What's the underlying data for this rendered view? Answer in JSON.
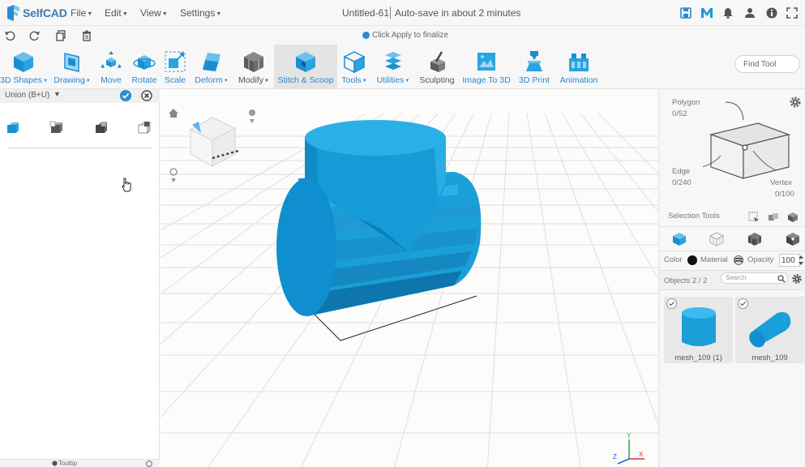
{
  "app": {
    "name": "SelfCAD"
  },
  "menu": [
    "File",
    "Edit",
    "View",
    "Settings"
  ],
  "document": {
    "title": "Untitled-61",
    "autosave": "Auto-save in about 2 minutes"
  },
  "hint": "Click Apply to finalize",
  "toolbar": [
    {
      "label": "3D Shapes",
      "dropdown": true
    },
    {
      "label": "Drawing",
      "dropdown": true
    },
    {
      "label": "Move",
      "dropdown": false
    },
    {
      "label": "Rotate",
      "dropdown": false
    },
    {
      "label": "Scale",
      "dropdown": false
    },
    {
      "label": "Deform",
      "dropdown": true
    },
    {
      "label": "Modify",
      "dropdown": true
    },
    {
      "label": "Stitch & Scoop",
      "dropdown": false,
      "active": true
    },
    {
      "label": "Tools",
      "dropdown": true
    },
    {
      "label": "Utilities",
      "dropdown": true
    },
    {
      "label": "Sculpting",
      "dropdown": false
    },
    {
      "label": "Image To 3D",
      "dropdown": false
    },
    {
      "label": "3D Print",
      "dropdown": false
    },
    {
      "label": "Animation",
      "dropdown": false
    }
  ],
  "find_tool": {
    "placeholder": "Find Tool"
  },
  "left_panel": {
    "title": "Union (B+U)",
    "operations": [
      "union-icon",
      "subtract-icon",
      "intersect-icon",
      "slice-icon"
    ],
    "footer": "Tooltip"
  },
  "right_panel": {
    "polygon": {
      "label": "Polygon",
      "count": "0/52"
    },
    "edge": {
      "label": "Edge",
      "count": "0/240"
    },
    "vertex": {
      "label": "Vertex",
      "count": "0/100"
    },
    "selection_tools": "Selection Tools",
    "color_label": "Color",
    "material_label": "Material",
    "opacity_label": "Opacity",
    "opacity_value": "100",
    "objects_label": "Objects 2 / 2",
    "search_placeholder": "Search",
    "objects": [
      {
        "name": "mesh_109 (1)"
      },
      {
        "name": "mesh_109"
      }
    ]
  },
  "colors": {
    "accent": "#2a8bd3",
    "mesh": "#1aa0d6",
    "brand": "#3a7bb3"
  }
}
